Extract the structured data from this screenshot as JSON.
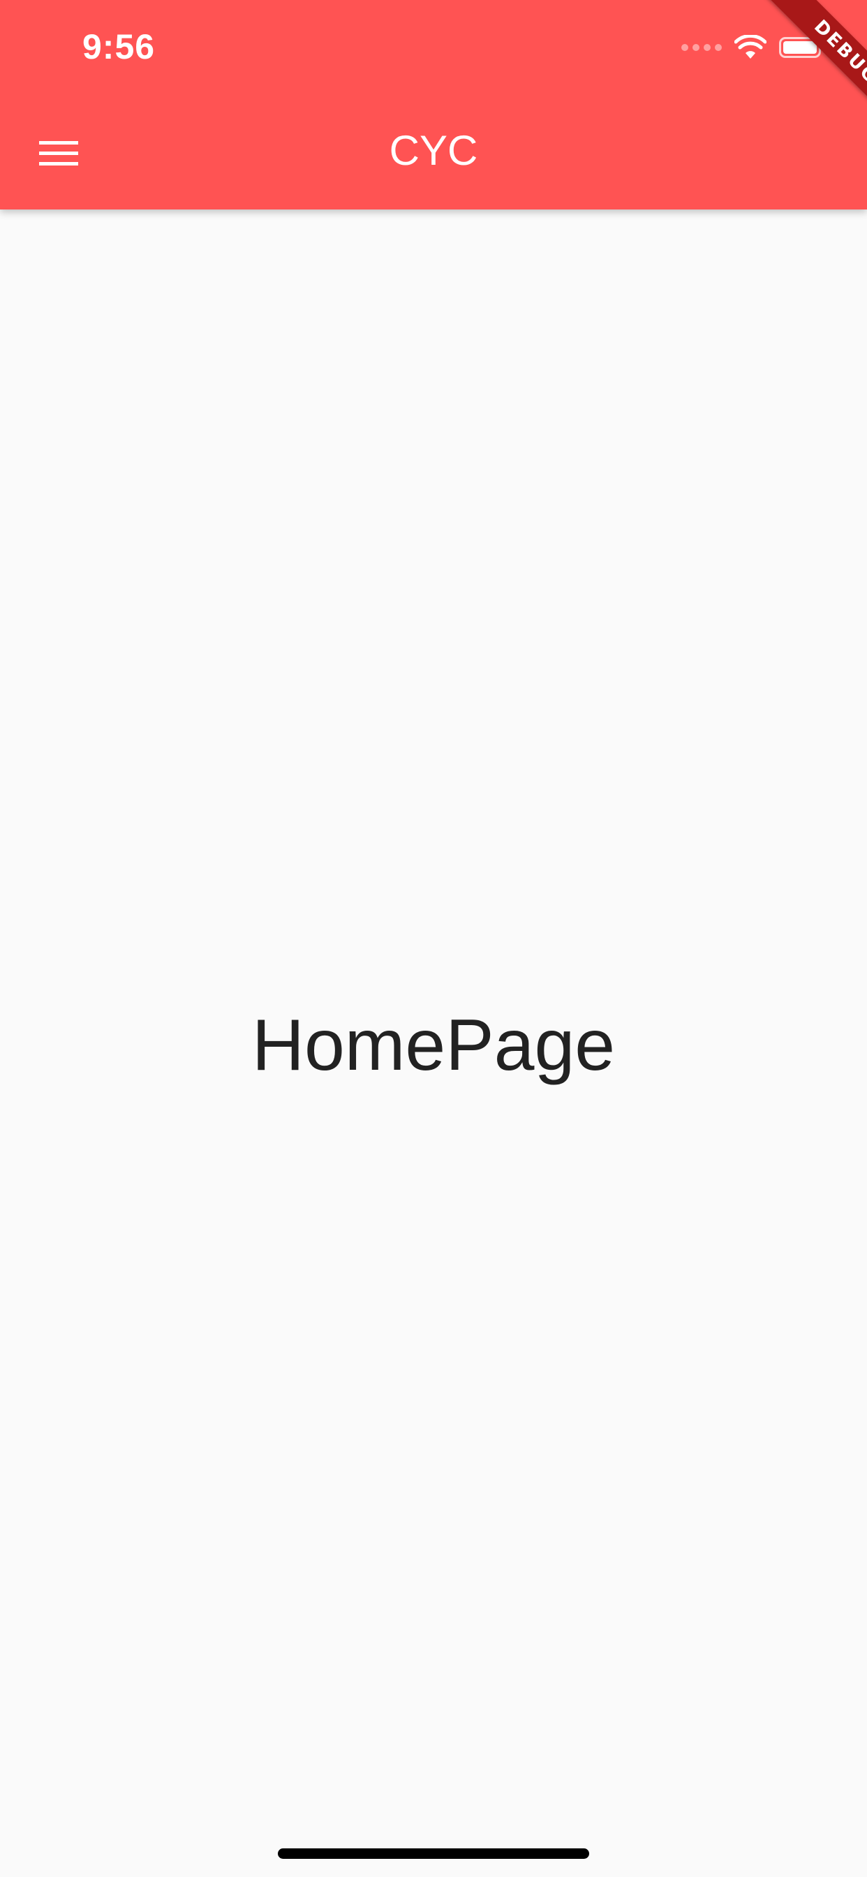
{
  "status_bar": {
    "time": "9:56"
  },
  "app_bar": {
    "title": "CYC",
    "menu_icon": "hamburger-menu-icon",
    "background_color": "#FF5353"
  },
  "main": {
    "text": "HomePage"
  },
  "debug_banner": {
    "label": "DEBUG"
  }
}
